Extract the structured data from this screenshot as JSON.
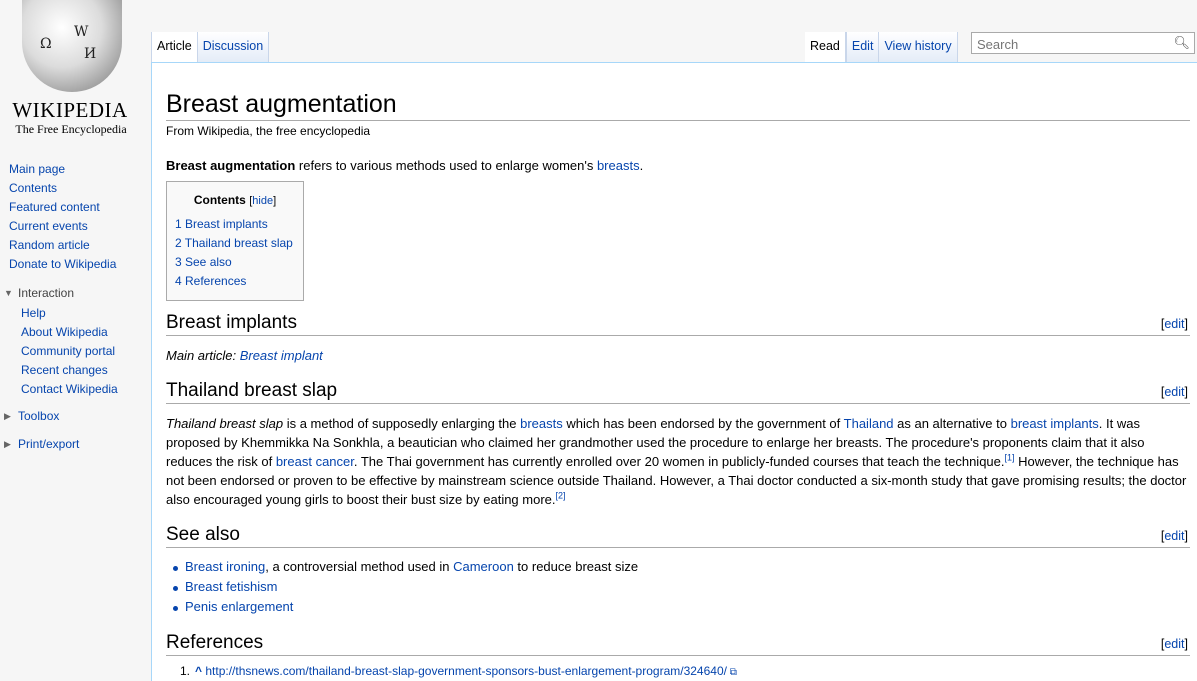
{
  "logo": {
    "wordmark": "WIKIPEDIA",
    "tagline": "The Free Encyclopedia",
    "globe_glyphs": [
      "Ω",
      "W",
      "И"
    ]
  },
  "sidebar": {
    "main": [
      "Main page",
      "Contents",
      "Featured content",
      "Current events",
      "Random article",
      "Donate to Wikipedia"
    ],
    "interaction_label": "Interaction",
    "interaction": [
      "Help",
      "About Wikipedia",
      "Community portal",
      "Recent changes",
      "Contact Wikipedia"
    ],
    "toolbox_label": "Toolbox",
    "print_label": "Print/export"
  },
  "tabs": {
    "article": "Article",
    "discussion": "Discussion",
    "read": "Read",
    "edit": "Edit",
    "history": "View history"
  },
  "search": {
    "placeholder": "Search"
  },
  "article": {
    "title": "Breast augmentation",
    "tagline": "From Wikipedia, the free encyclopedia",
    "intro_bold": "Breast augmentation",
    "intro_text": " refers to various methods used to enlarge women's ",
    "intro_link": "breasts",
    "intro_end": "."
  },
  "toc": {
    "title": "Contents",
    "hide": "hide",
    "items": [
      "1 Breast implants",
      "2 Thailand breast slap",
      "3 See also",
      "4 References"
    ]
  },
  "sections": {
    "edit_label": "edit",
    "implants": "Breast implants",
    "slap": "Thailand breast slap",
    "see_also": "See also",
    "references": "References"
  },
  "hatnote": {
    "prefix": "Main article: ",
    "link": "Breast implant"
  },
  "slap": {
    "t1": "Thailand breast slap",
    "t2": " is a method of supposedly enlarging the ",
    "l1": "breasts",
    "t3": " which has been endorsed by the government of ",
    "l2": "Thailand",
    "t4": " as an alternative to ",
    "l3": "breast implants",
    "t5": ". It was proposed by Khemmikka Na Sonkhla, a beautician who claimed her grandmother used the procedure to enlarge her breasts. The procedure's proponents claim that it also reduces the risk of ",
    "l4": "breast cancer",
    "t6": ". The Thai government has currently enrolled over 20 women in publicly-funded courses that teach the technique.",
    "ref1": "[1]",
    "t7": " However, the technique has not been endorsed or proven to be effective by mainstream science outside Thailand. However, a Thai doctor conducted a six-month study that gave promising results; the doctor also encouraged young girls to boost their bust size by eating more.",
    "ref2": "[2]"
  },
  "see_also": {
    "i1_link": "Breast ironing",
    "i1_text": ", a controversial method used in ",
    "i1_link2": "Cameroon",
    "i1_end": " to reduce breast size",
    "i2": "Breast fetishism",
    "i3": "Penis enlargement"
  },
  "references": {
    "num": "1.",
    "caret": "^",
    "url": "http://thsnews.com/thailand-breast-slap-government-sponsors-bust-enlargement-program/324640/"
  }
}
